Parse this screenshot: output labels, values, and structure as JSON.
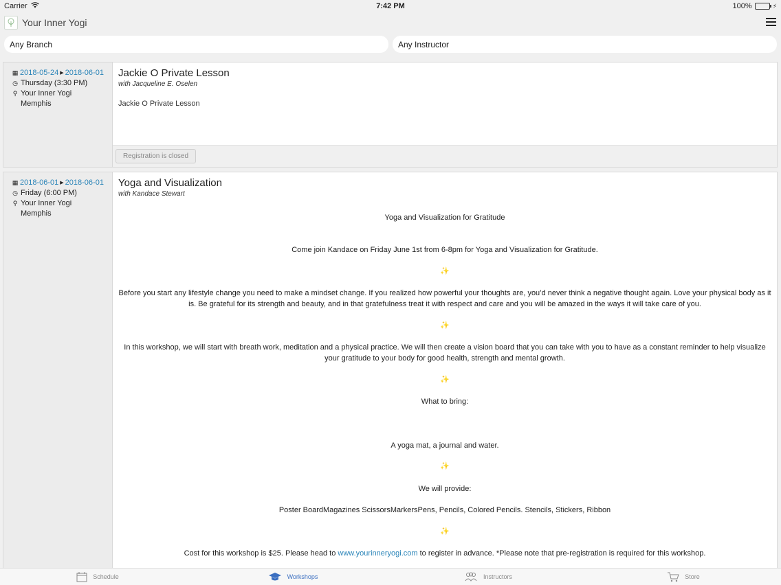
{
  "status_bar": {
    "carrier": "Carrier",
    "time": "7:42 PM",
    "battery": "100%",
    "battery_level": 1.0
  },
  "nav": {
    "title": "Your Inner Yogi"
  },
  "filters": {
    "branch": "Any Branch",
    "instructor": "Any Instructor"
  },
  "workshops": [
    {
      "start_date": "2018-05-24",
      "end_date": "2018-06-01",
      "day_time": "Thursday (3:30 PM)",
      "location_line1": "Your Inner Yogi",
      "location_line2": "Memphis",
      "title": "Jackie O Private Lesson",
      "instructor": "with Jacqueline E. Oselen",
      "description": "Jackie O Private Lesson",
      "registration": "Registration is closed"
    },
    {
      "start_date": "2018-06-01",
      "end_date": "2018-06-01",
      "day_time": "Friday (6:00 PM)",
      "location_line1": "Your Inner Yogi",
      "location_line2": "Memphis",
      "title": "Yoga and Visualization",
      "instructor": "with Kandace Stewart",
      "paragraphs": {
        "p1": "Yoga and Visualization for Gratitude",
        "p2": "Come join Kandace on Friday June 1st from 6-8pm for Yoga and Visualization for Gratitude.",
        "p3": "Before you start any lifestyle change you need to make a mindset change. If you realized how powerful your thoughts are, you’d never think a negative thought again. Love your physical body as it is. Be grateful for its strength and beauty, and in that gratefulness treat it with respect and care and you will be amazed in the ways it will take care of you.",
        "p4": "In this workshop, we will start with breath work, meditation and a physical practice. We will then create a vision board that you can take with you to have as a constant reminder to help visualize your gratitude to your body for good health, strength and mental growth.",
        "p5": "What to bring:",
        "p6": "A yoga mat, a journal and water.",
        "p7": "We will provide:",
        "p8": "Poster BoardMagazines ScissorsMarkersPens, Pencils, Colored Pencils. Stencils, Stickers, Ribbon",
        "p9_before": "Cost for this workshop is $25. Please head to ",
        "p9_link": "www.yourinneryogi.com",
        "p9_after": " to register in advance. *Please note that pre-registration is required for this workshop."
      },
      "sparkle": "✨"
    }
  ],
  "tabs": [
    {
      "label": "Schedule",
      "icon": "calendar-icon"
    },
    {
      "label": "Workshops",
      "icon": "graduation-cap-icon"
    },
    {
      "label": "Instructors",
      "icon": "people-icon"
    },
    {
      "label": "Store",
      "icon": "cart-icon"
    }
  ],
  "colors": {
    "accent": "#2a84b8",
    "tab_active": "#3b6fc1",
    "sparkle": "#f3c341",
    "battery": "#3ec645"
  }
}
